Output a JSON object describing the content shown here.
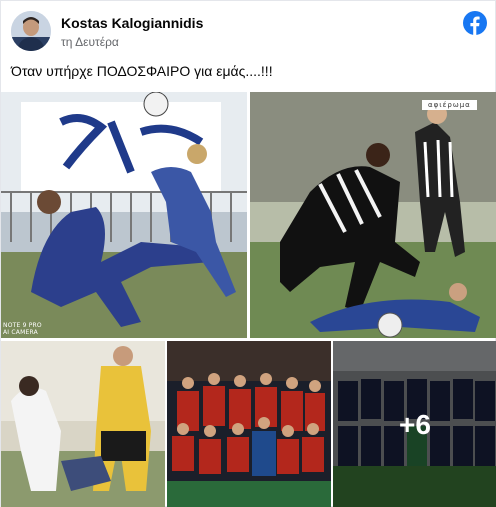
{
  "post": {
    "author": "Kostas Kalogiannidis",
    "time": "τη Δευτέρα",
    "text": "Όταν υπήρχε ΠΟΔΟΣΦΑΙΡΟ για εμάς....!!!"
  },
  "colors": {
    "facebook_blue": "#1877f2",
    "secondary_text": "#65676b"
  },
  "icons": {
    "platform": "facebook-logo-icon"
  },
  "photos": {
    "watermark_line1": "NOTE 9 PRO",
    "watermark_line2": "AI CAMERA",
    "stamp": "αφιέρωμα",
    "more_count": "+6"
  }
}
